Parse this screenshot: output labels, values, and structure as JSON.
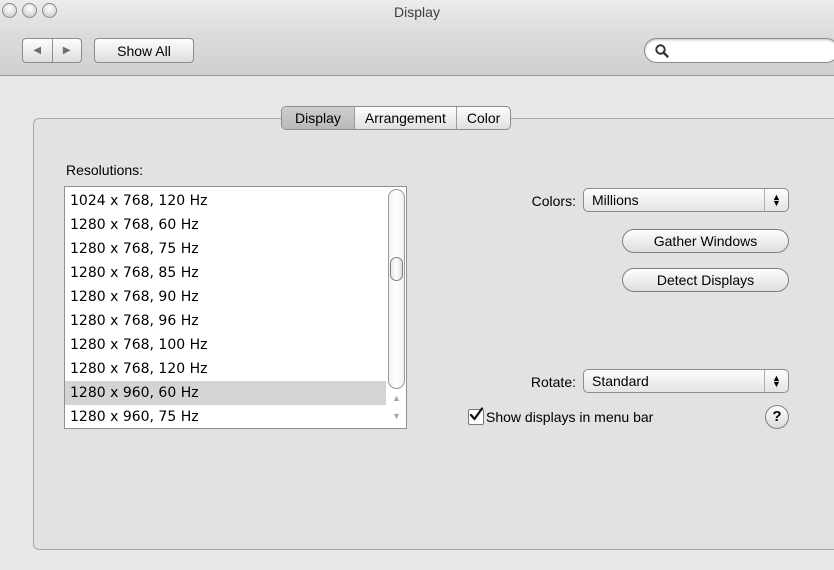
{
  "window": {
    "title": "Display"
  },
  "toolbar": {
    "back_label": "◀",
    "forward_label": "▶",
    "show_all_label": "Show All",
    "search": {
      "value": "",
      "placeholder": ""
    }
  },
  "tabs": [
    {
      "label": "Display",
      "selected": true
    },
    {
      "label": "Arrangement",
      "selected": false
    },
    {
      "label": "Color",
      "selected": false
    }
  ],
  "resolutions": {
    "label": "Resolutions:",
    "items": [
      "1024 x 768, 120 Hz",
      "1280 x 768, 60 Hz",
      "1280 x 768, 75 Hz",
      "1280 x 768, 85 Hz",
      "1280 x 768, 90 Hz",
      "1280 x 768, 96 Hz",
      "1280 x 768, 100 Hz",
      "1280 x 768, 120 Hz",
      "1280 x 960, 60 Hz",
      "1280 x 960, 75 Hz"
    ],
    "selected_index": 8
  },
  "colors": {
    "label": "Colors:",
    "value": "Millions"
  },
  "gather_windows_label": "Gather Windows",
  "detect_displays_label": "Detect Displays",
  "rotate": {
    "label": "Rotate:",
    "value": "Standard"
  },
  "show_in_menu_bar": {
    "label": "Show displays in menu bar",
    "checked": true
  },
  "help_label": "?"
}
